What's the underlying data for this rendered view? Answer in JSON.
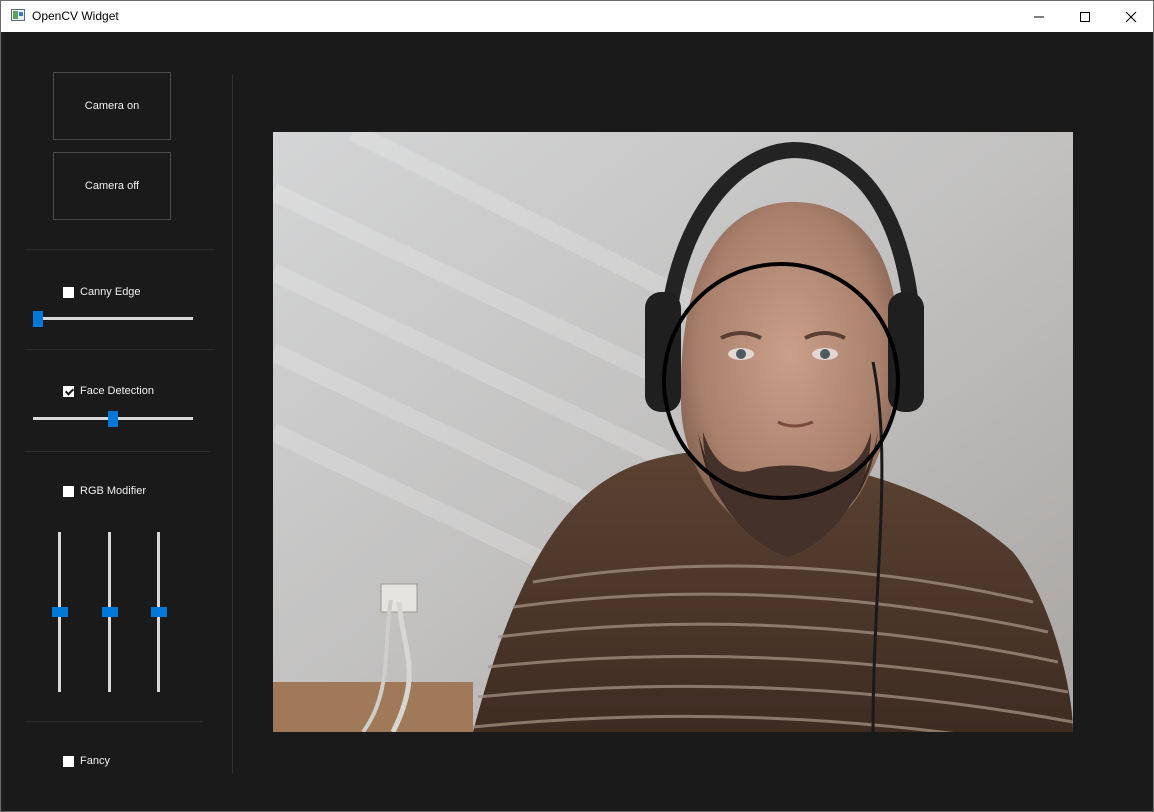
{
  "window": {
    "title": "OpenCV Widget",
    "minimize_icon": "minimize-icon",
    "maximize_icon": "maximize-icon",
    "close_icon": "close-icon"
  },
  "controls": {
    "camera_on_label": "Camera on",
    "camera_off_label": "Camera off",
    "canny": {
      "label": "Canny Edge",
      "checked": false,
      "slider_value": 0.03
    },
    "face": {
      "label": "Face Detection",
      "checked": true,
      "slider_value": 0.5
    },
    "rgb": {
      "label": "RGB Modifier",
      "checked": false,
      "sliders": [
        0.5,
        0.5,
        0.5
      ]
    },
    "fancy": {
      "label": "Fancy",
      "checked": false
    }
  },
  "colors": {
    "accent": "#0078d7",
    "background": "#1a1a1a",
    "text": "#f0f0f0"
  }
}
